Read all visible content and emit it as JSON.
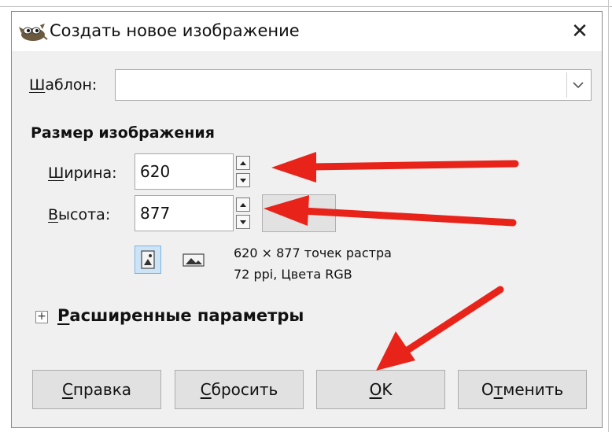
{
  "window": {
    "title": "Создать новое изображение",
    "close_symbol": "✕",
    "app_icon": "gimp-wilber-icon"
  },
  "template": {
    "label_mnemonic": "Ш",
    "label_rest": "аблон:",
    "value": ""
  },
  "image_size": {
    "heading": "Размер изображения",
    "width": {
      "label_mnemonic": "Ш",
      "label_rest": "ирина:",
      "value": "620"
    },
    "height": {
      "label_mnemonic": "В",
      "label_rest": "ысота:",
      "value": "877"
    },
    "info_line1": "620 × 877 точек растра",
    "info_line2": "72 ppi, Цвета RGB",
    "orientation_selected": "portrait"
  },
  "advanced": {
    "expander_symbol": "+",
    "label_mnemonic": "Р",
    "label_rest": "асширенные параметры"
  },
  "buttons": {
    "help": {
      "mnemonic": "С",
      "rest": "правка"
    },
    "reset": {
      "mnemonic": "С",
      "rest": "бросить"
    },
    "ok": {
      "mnemonic": "О",
      "rest": "K"
    },
    "cancel": {
      "pre": "О",
      "mnemonic": "т",
      "rest": "менить"
    }
  },
  "annotations": {
    "arrow_color": "#e8231a"
  }
}
